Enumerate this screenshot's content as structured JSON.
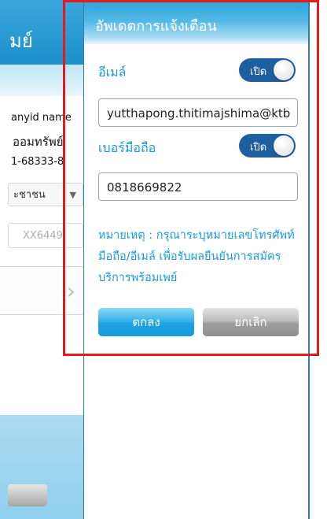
{
  "background": {
    "header_title": "มย์",
    "line1": "anyid name",
    "line2": "ออมทรัพย์",
    "line3": "1-68333-8",
    "select_value": "ะชาชน",
    "input_value": "XX6449"
  },
  "modal": {
    "title": "อัพเดตการแจ้งเตือน",
    "email": {
      "label": "อีเมล์",
      "toggle_label": "เปิด",
      "value": "yutthapong.thitimajshima@ktb"
    },
    "phone": {
      "label": "เบอร์มือถือ",
      "toggle_label": "เปิด",
      "value": "0818669822"
    },
    "note": "หมายเหตุ : กรุณาระบุหมายเลขโทรศัพท์มือถือ/อีเมล์ เพื่อรับผลยืนยันการสมัครบริการพร้อมเพย์",
    "ok_label": "ตกลง",
    "cancel_label": "ยกเลิก"
  },
  "colors": {
    "accent": "#1a9ad8",
    "toggle_on": "#1e5fa0",
    "highlight": "#e41b1b"
  }
}
